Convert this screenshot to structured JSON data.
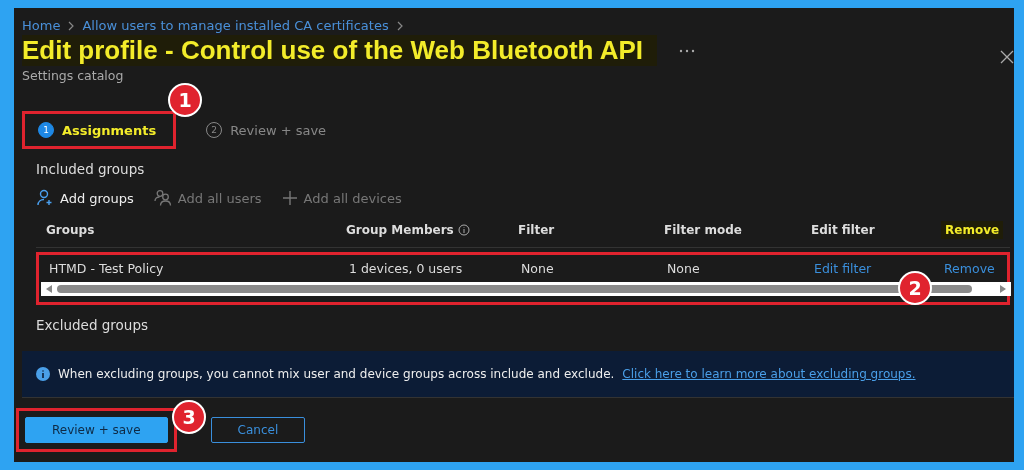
{
  "breadcrumb": [
    {
      "label": "Home"
    },
    {
      "label": "Allow users to manage installed CA certificates"
    }
  ],
  "title": {
    "text": "Edit profile - Control use of the Web Bluetooth API",
    "highlighted": true
  },
  "subtitle": "Settings catalog",
  "tabs": [
    {
      "number": "1",
      "label": "Assignments",
      "selected": true,
      "highlighted": true,
      "badge": "1"
    },
    {
      "number": "2",
      "label": "Review + save",
      "selected": false,
      "highlighted": false
    }
  ],
  "included": {
    "heading": "Included groups",
    "toolbar": [
      {
        "label": "Add groups",
        "disabled": false
      },
      {
        "label": "Add all users",
        "disabled": true
      },
      {
        "label": "Add all devices",
        "disabled": true
      }
    ],
    "columns": [
      {
        "label": "Groups",
        "info": false,
        "highlighted": false
      },
      {
        "label": "Group Members",
        "info": true,
        "highlighted": false
      },
      {
        "label": "Filter",
        "info": false,
        "highlighted": false
      },
      {
        "label": "Filter mode",
        "info": false,
        "highlighted": false
      },
      {
        "label": "Edit filter",
        "info": false,
        "highlighted": false
      },
      {
        "label": "Remove",
        "info": false,
        "highlighted": true
      }
    ],
    "rows": [
      {
        "highlighted": true,
        "badge": "2",
        "cells": [
          {
            "text": "HTMD - Test Policy",
            "kind": "text"
          },
          {
            "text": "1 devices, 0 users",
            "kind": "text"
          },
          {
            "text": "None",
            "kind": "text"
          },
          {
            "text": "None",
            "kind": "text"
          },
          {
            "text": "Edit filter",
            "kind": "link"
          },
          {
            "text": "Remove",
            "kind": "link"
          }
        ]
      }
    ]
  },
  "excluded": {
    "heading": "Excluded groups",
    "info_text": "When excluding groups, you cannot mix user and device groups across include and exclude.",
    "info_link": "Click here to learn more about excluding groups."
  },
  "footer": {
    "buttons": [
      {
        "label": "Review + save",
        "kind": "primary",
        "highlighted": true,
        "badge": "3"
      },
      {
        "label": "Cancel",
        "kind": "secondary",
        "highlighted": false
      }
    ]
  }
}
